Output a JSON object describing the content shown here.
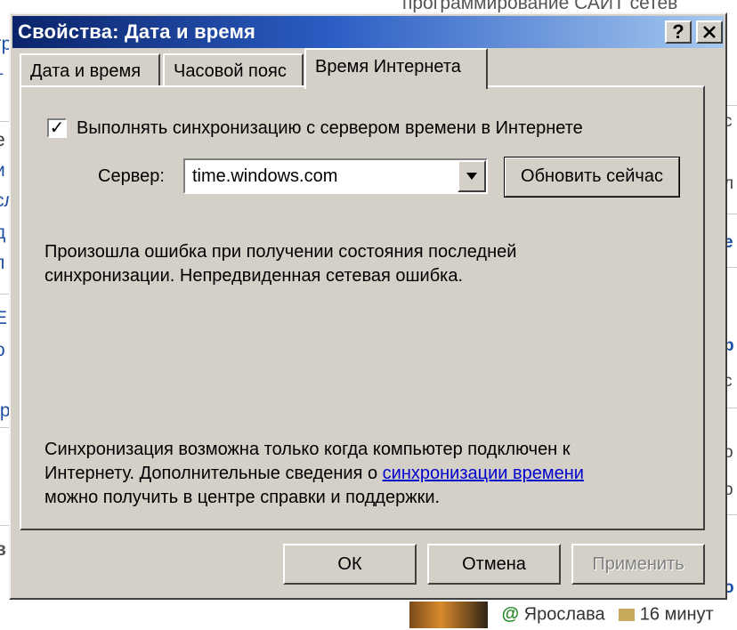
{
  "window": {
    "title": "Свойства: Дата и время",
    "help_symbol": "?",
    "close_symbol": "✕"
  },
  "tabs": [
    {
      "label": "Дата и время",
      "selected": false
    },
    {
      "label": "Часовой пояс",
      "selected": false
    },
    {
      "label": "Время Интернета",
      "selected": true
    }
  ],
  "sync": {
    "checked": true,
    "check_mark": "✓",
    "label": "Выполнять синхронизацию с сервером времени в Интернете"
  },
  "server": {
    "label": "Сервер:",
    "value": "time.windows.com",
    "update_button": "Обновить сейчас"
  },
  "messages": {
    "error_line1": "Произошла ошибка при получении состояния последней",
    "error_line2": "синхронизации.  Непредвиденная сетевая ошибка.",
    "info_line1": "Синхронизация возможна только когда компьютер подключен к",
    "info_line2_prefix": "Интернету. Дополнительные сведения о ",
    "info_link": "синхронизации времени",
    "info_line3": "можно получить в центре справки и поддержки."
  },
  "buttons": {
    "ok": "ОК",
    "cancel": "Отмена",
    "apply": "Применить"
  },
  "background": {
    "top_text": "программирование САЙТ сетев",
    "bottom_user": "Ярослава",
    "bottom_time": "16 минут",
    "at_sign": "@"
  },
  "colors": {
    "title_start": "#0a246a",
    "title_end": "#a6caf0",
    "face": "#d4d0c8",
    "link": "#0000cc"
  }
}
